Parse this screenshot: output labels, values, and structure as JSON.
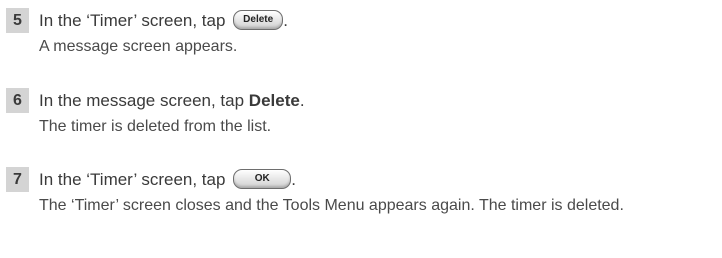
{
  "steps": [
    {
      "number": "5",
      "title_prefix": "In the ‘Timer’ screen, tap",
      "title_bold": "",
      "button_label": "Delete",
      "title_suffix": ".",
      "body": "A message screen appears."
    },
    {
      "number": "6",
      "title_prefix": "In the message screen, tap ",
      "title_bold": "Delete",
      "button_label": "",
      "title_suffix": ".",
      "body": "The timer is deleted from the list."
    },
    {
      "number": "7",
      "title_prefix": "In the ‘Timer’ screen, tap",
      "title_bold": "",
      "button_label": "OK",
      "title_suffix": ".",
      "body": "The ‘Timer’ screen closes and the Tools Menu appears again. The timer is deleted."
    }
  ]
}
